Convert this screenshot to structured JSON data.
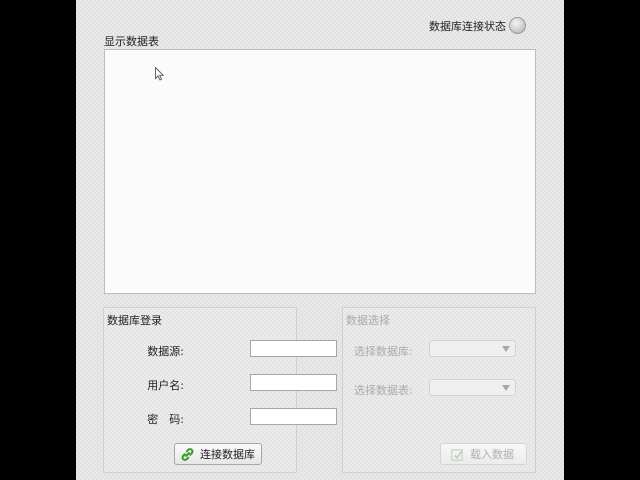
{
  "status": {
    "label": "数据库连接状态",
    "state": "disconnected",
    "led_color": "#c4c4c4"
  },
  "table": {
    "label": "显示数据表"
  },
  "login": {
    "title": "数据库登录",
    "fields": [
      {
        "label": "数据源:",
        "value": ""
      },
      {
        "label": "用户名:",
        "value": ""
      },
      {
        "label": "密　码:",
        "value": ""
      }
    ],
    "connect_button": {
      "label": "连接数据库",
      "icon": "link-icon"
    }
  },
  "select": {
    "title": "数据选择",
    "disabled": true,
    "database_label": "选择数据库:",
    "table_label": "选择数据表:",
    "database_value": "",
    "table_value": "",
    "load_button": {
      "label": "载入数据",
      "icon": "load-data-icon"
    }
  },
  "colors": {
    "window_bg": "#e9e9e9",
    "disabled_text": "#ababab",
    "link_icon": "#3a9a2a"
  }
}
